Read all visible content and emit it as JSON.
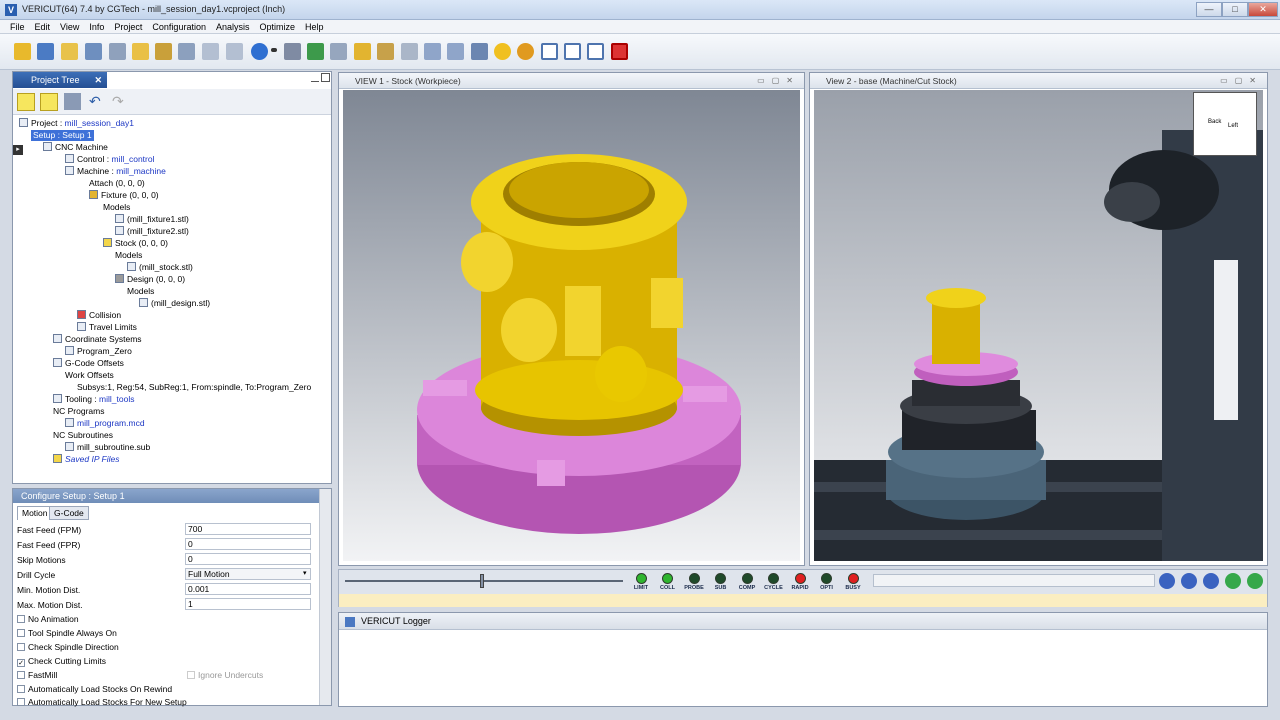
{
  "window": {
    "title": "VERICUT(64)  7.4 by CGTech - mill_session_day1.vcproject (Inch)",
    "min": "—",
    "max": "□",
    "close": "✕"
  },
  "menu": [
    "File",
    "Edit",
    "View",
    "Info",
    "Project",
    "Configuration",
    "Analysis",
    "Optimize",
    "Help"
  ],
  "project_tree": {
    "tab_label": "Project Tree",
    "items": [
      {
        "label": "Project : ",
        "value": "mill_session_day1"
      },
      {
        "label": "Setup : Setup 1"
      },
      {
        "label": "CNC Machine"
      },
      {
        "label": "Control : ",
        "value": "mill_control"
      },
      {
        "label": "Machine : ",
        "value": "mill_machine"
      },
      {
        "label": "Attach (0, 0, 0)"
      },
      {
        "label": "Fixture (0, 0, 0)"
      },
      {
        "label": "Models"
      },
      {
        "label": "(mill_fixture1.stl)"
      },
      {
        "label": "(mill_fixture2.stl)"
      },
      {
        "label": "Stock (0, 0, 0)"
      },
      {
        "label": "Models"
      },
      {
        "label": "(mill_stock.stl)"
      },
      {
        "label": "Design (0, 0, 0)"
      },
      {
        "label": "Models"
      },
      {
        "label": "(mill_design.stl)"
      },
      {
        "label": "Collision"
      },
      {
        "label": "Travel Limits"
      },
      {
        "label": "Coordinate Systems"
      },
      {
        "label": "Program_Zero"
      },
      {
        "label": "G-Code Offsets"
      },
      {
        "label": "Work Offsets"
      },
      {
        "label": "Subsys:1, Reg:54, SubReg:1, From:spindle, To:Program_Zero"
      },
      {
        "label": "Tooling : ",
        "value": "mill_tools"
      },
      {
        "label": "NC Programs"
      },
      {
        "label": "mill_program.mcd"
      },
      {
        "label": "NC Subroutines"
      },
      {
        "label": "mill_subroutine.sub"
      },
      {
        "label": "Saved IP Files"
      }
    ]
  },
  "config": {
    "title": "Configure Setup : Setup 1",
    "tabs": [
      "Motion",
      "G-Code"
    ],
    "fields": [
      {
        "label": "Fast Feed (FPM)",
        "value": "700"
      },
      {
        "label": "Fast Feed (FPR)",
        "value": "0"
      },
      {
        "label": "Skip Motions",
        "value": "0"
      },
      {
        "label": "Drill Cycle",
        "value": "Full Motion"
      },
      {
        "label": "Min. Motion Dist.",
        "value": "0.001"
      },
      {
        "label": "Max. Motion Dist.",
        "value": "1"
      }
    ],
    "checks": [
      {
        "label": "No Animation",
        "checked": false
      },
      {
        "label": "Tool Spindle Always On",
        "checked": false
      },
      {
        "label": "Check Spindle Direction",
        "checked": false
      },
      {
        "label": "Check Cutting Limits",
        "checked": true
      },
      {
        "label": "FastMill",
        "checked": false
      },
      {
        "label": "Automatically Load Stocks On Rewind",
        "checked": false
      },
      {
        "label": "Automatically Load Stocks For New Setup",
        "checked": false
      }
    ],
    "ignore_undercuts": "Ignore Undercuts",
    "check_mark": "✓"
  },
  "views": {
    "v1_title": "VIEW 1 - Stock (Workpiece)",
    "v2_title": "View 2 - base (Machine/Cut Stock)",
    "cube_back": "Back",
    "cube_left": "Left"
  },
  "leds": [
    {
      "label": "LIMIT",
      "color": "#2fb52f"
    },
    {
      "label": "COLL",
      "color": "#2fb52f"
    },
    {
      "label": "PROBE",
      "color": "#1f4a2a"
    },
    {
      "label": "SUB",
      "color": "#1f4a2a"
    },
    {
      "label": "COMP",
      "color": "#1f4a2a"
    },
    {
      "label": "CYCLE",
      "color": "#1f4a2a"
    },
    {
      "label": "RAPID",
      "color": "#e02020"
    },
    {
      "label": "OPTI",
      "color": "#1f4a2a"
    },
    {
      "label": "BUSY",
      "color": "#e02020"
    }
  ],
  "logger": {
    "title": "VERICUT Logger"
  }
}
